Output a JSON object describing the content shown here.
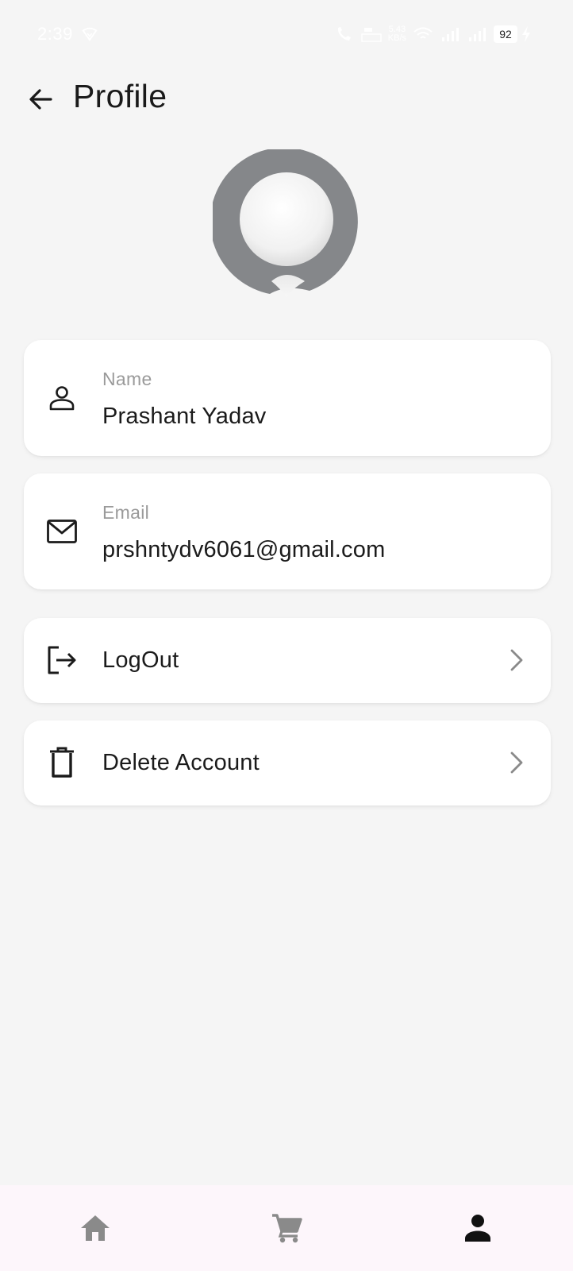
{
  "status_bar": {
    "time": "2:39",
    "speed_top": "5.43",
    "speed_bottom": "KB/s",
    "battery": "92",
    "icons": [
      "signal-icon",
      "wifi-icon",
      "battery-icon",
      "charging-icon"
    ]
  },
  "header": {
    "back_icon": "arrow-left-icon",
    "title": "Profile"
  },
  "profile": {
    "name_label": "Name",
    "name_value": "Prashant Yadav",
    "email_label": "Email",
    "email_value": "prshntydv6061@gmail.com"
  },
  "actions": {
    "logout_label": "LogOut",
    "delete_label": "Delete Account"
  },
  "bottom_nav": {
    "items": [
      "home-icon",
      "cart-icon",
      "person-icon"
    ],
    "active": "person-icon"
  },
  "colors": {
    "background": "#f5f5f5",
    "card": "#ffffff",
    "label_gray": "#9a9a9a",
    "text_dark": "#1b1b1b",
    "nav_background": "#fdf6fb",
    "nav_inactive": "#8a8a8a",
    "avatar_ring": "#85878a"
  }
}
